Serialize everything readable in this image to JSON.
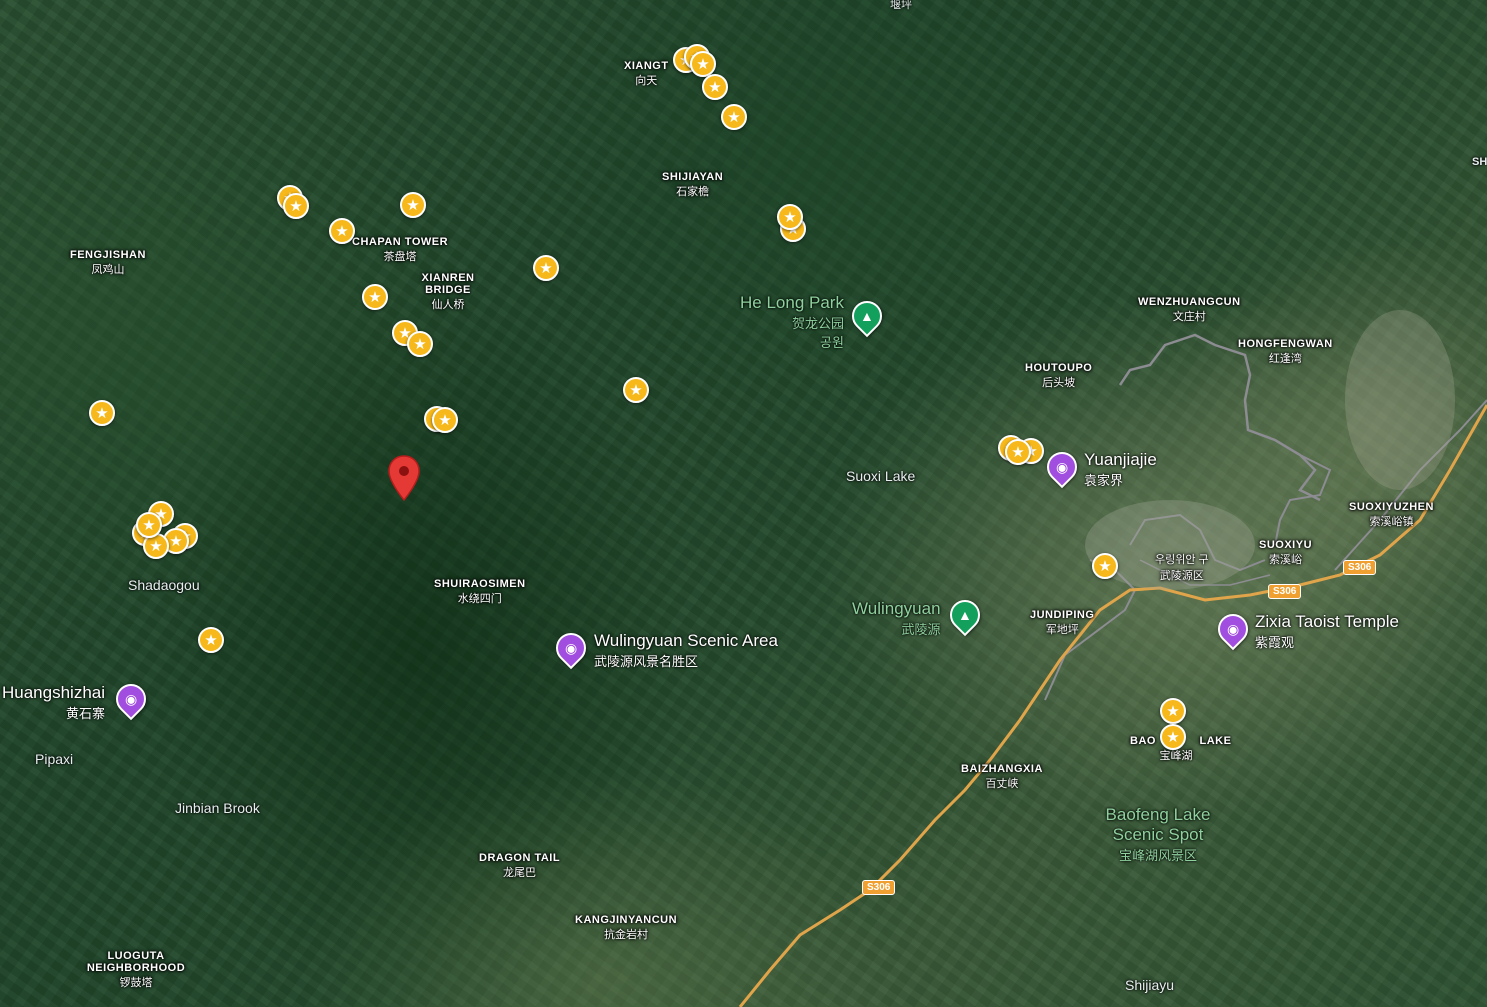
{
  "map": {
    "view": "satellite"
  },
  "places": [
    {
      "en": "FENGJISHAN",
      "zh": "凤鸡山"
    },
    {
      "en": "CHAPAN TOWER",
      "zh": "茶盘塔"
    },
    {
      "en": "XIANREN BRIDGE",
      "zh": "仙人桥"
    },
    {
      "en": "XIANGT",
      "zh": "向天"
    },
    {
      "en": "SHIJIAYAN",
      "zh": "石家檐"
    },
    {
      "en": "WENZHUANGCUN",
      "zh": "文庄村"
    },
    {
      "en": "HONGFENGWAN",
      "zh": "红逢湾"
    },
    {
      "en": "HOUTOUPO",
      "zh": "后头坡"
    },
    {
      "en": "SHUIRAOSIMEN",
      "zh": "水绕四门"
    },
    {
      "en": "SUOXIYUZHEN",
      "zh": "索溪峪镇"
    },
    {
      "en": "SUOXIYU",
      "zh": "索溪峪"
    },
    {
      "en": "JUNDIPING",
      "zh": "军地坪"
    },
    {
      "en": "BAIZHANGXIA",
      "zh": "百丈峡"
    },
    {
      "en": "BAO LAKE",
      "zh": "宝峰湖"
    },
    {
      "en": "DRAGON TAIL",
      "zh": "龙尾巴"
    },
    {
      "en": "KANGJINYANCUN",
      "zh": "抗金岩村"
    },
    {
      "en": "LUOGUTA NEIGHBORHOOD",
      "zh": "锣鼓塔"
    },
    {
      "en": "",
      "zh": "우링위안 구"
    },
    {
      "en": "",
      "zh": "武陵源区"
    }
  ],
  "plain_labels": {
    "suoxi_lake": "Suoxi Lake",
    "shadaogou": "Shadaogou",
    "pipaxi": "Pipaxi",
    "jinbian_brook": "Jinbian Brook",
    "shijiayu": "Shijiayu",
    "top_cut": "堰坪",
    "right_cut": "SH"
  },
  "pois": {
    "he_long_park": {
      "title": "He Long Park",
      "sub": "贺龙公园",
      "sub2": "공원"
    },
    "yuanjiajie": {
      "title": "Yuanjiajie",
      "sub": "袁家界"
    },
    "wulingyuan_scenic": {
      "title": "Wulingyuan Scenic Area",
      "sub": "武陵源风景名胜区"
    },
    "wulingyuan": {
      "title": "Wulingyuan",
      "sub": "武陵源"
    },
    "zixia": {
      "title": "Zixia Taoist Temple",
      "sub": "紫霞观"
    },
    "huangshizhai": {
      "title": "Huangshizhai",
      "sub": "黄石寨"
    },
    "baofeng": {
      "title": "Baofeng Lake Scenic Spot",
      "sub": "宝峰湖风景区"
    }
  },
  "road_shields": [
    "S306",
    "S306",
    "S306"
  ],
  "icons": {
    "star": "★",
    "camera": "◉",
    "tree": "▲"
  }
}
